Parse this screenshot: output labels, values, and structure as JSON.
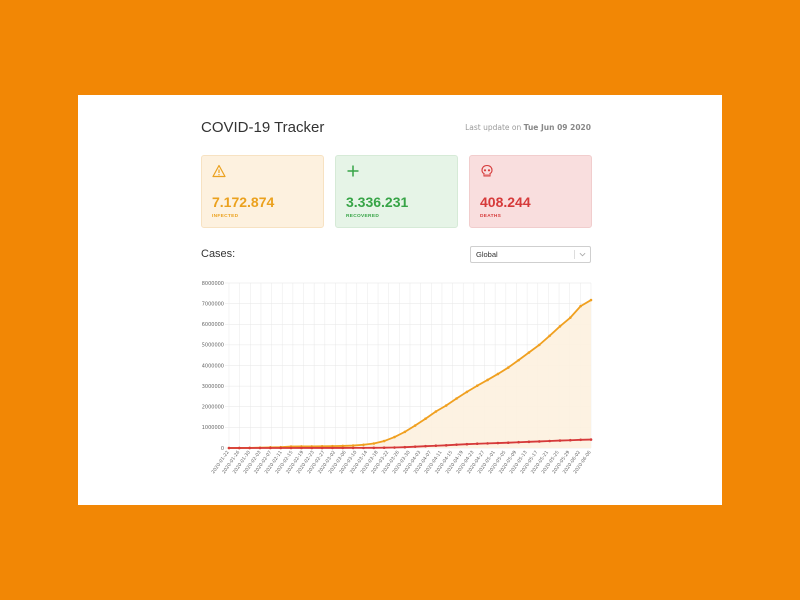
{
  "header": {
    "title": "COVID-19 Tracker",
    "last_update_prefix": "Last update on ",
    "last_update_date": "Tue Jun 09 2020"
  },
  "stats": [
    {
      "key": "infected",
      "value": "7.172.874",
      "label": "INFECTED",
      "icon": "warning-triangle-icon",
      "color": "#eba11e"
    },
    {
      "key": "recovered",
      "value": "3.336.231",
      "label": "RECOVERED",
      "icon": "plus-icon",
      "color": "#37a447"
    },
    {
      "key": "deaths",
      "value": "408.244",
      "label": "DEATHS",
      "icon": "skull-icon",
      "color": "#d63a3a"
    }
  ],
  "cases": {
    "label": "Cases:",
    "select_value": "Global"
  },
  "chart_data": {
    "type": "line",
    "ylim": [
      0,
      8000000
    ],
    "y_ticks": [
      0,
      1000000,
      2000000,
      3000000,
      4000000,
      5000000,
      6000000,
      7000000,
      8000000
    ],
    "x_tick_labels": [
      "2020-01-22",
      "2020-01-26",
      "2020-01-30",
      "2020-02-03",
      "2020-02-07",
      "2020-02-11",
      "2020-02-15",
      "2020-02-19",
      "2020-02-23",
      "2020-02-27",
      "2020-03-02",
      "2020-03-06",
      "2020-03-10",
      "2020-03-14",
      "2020-03-18",
      "2020-03-22",
      "2020-03-26",
      "2020-03-30",
      "2020-04-03",
      "2020-04-07",
      "2020-04-11",
      "2020-04-15",
      "2020-04-19",
      "2020-04-23",
      "2020-04-27",
      "2020-05-01",
      "2020-05-05",
      "2020-05-09",
      "2020-05-13",
      "2020-05-17",
      "2020-05-21",
      "2020-05-25",
      "2020-05-29",
      "2020-06-02",
      "2020-06-06"
    ],
    "series": [
      {
        "color": "#f0a020",
        "fill": "#fdf1df",
        "values": [
          555,
          2800,
          7800,
          17000,
          31000,
          43000,
          69000,
          75000,
          79000,
          82000,
          90000,
          101000,
          119000,
          157000,
          218000,
          337000,
          532000,
          782000,
          1090000,
          1420000,
          1770000,
          2060000,
          2400000,
          2720000,
          3020000,
          3300000,
          3590000,
          3900000,
          4260000,
          4630000,
          5000000,
          5440000,
          5900000,
          6320000,
          6880000,
          7172874
        ]
      },
      {
        "color": "#d63a3a",
        "values": [
          17,
          56,
          170,
          426,
          722,
          1018,
          1666,
          2122,
          2470,
          2800,
          3100,
          3460,
          4262,
          5800,
          8900,
          15000,
          23000,
          39000,
          64000,
          88000,
          110000,
          130000,
          161000,
          184000,
          207000,
          224000,
          240000,
          257000,
          280000,
          300000,
          318000,
          340000,
          360000,
          377000,
          397000,
          408244
        ]
      }
    ]
  }
}
